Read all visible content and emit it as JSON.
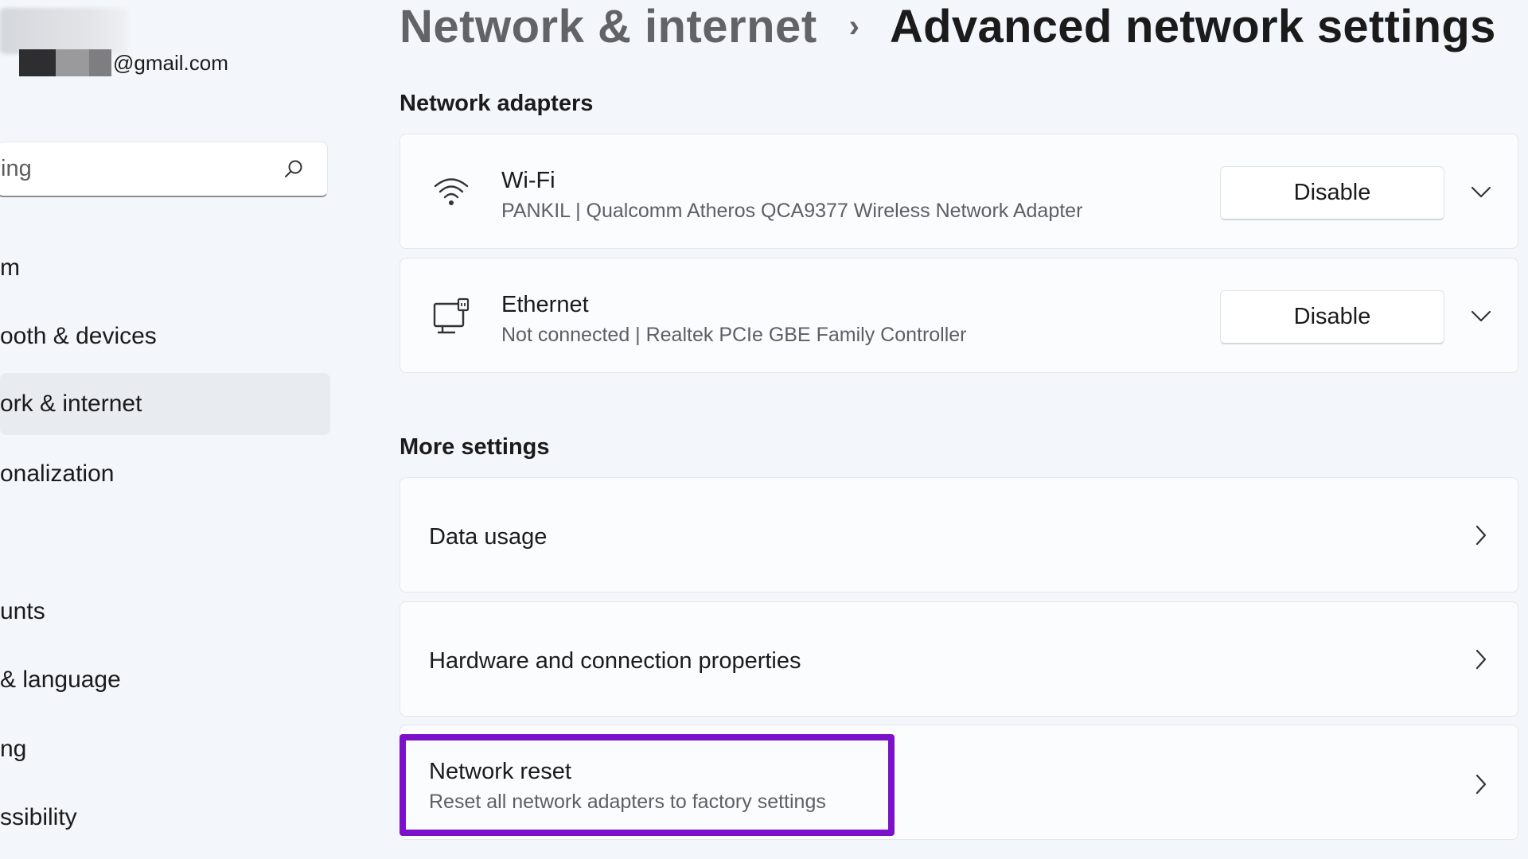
{
  "account": {
    "email_suffix": "@gmail.com"
  },
  "search": {
    "placeholder_fragment": "ing"
  },
  "sidebar": {
    "items": [
      {
        "label": "m"
      },
      {
        "label": "ooth & devices"
      },
      {
        "label": "ork & internet",
        "active": true
      },
      {
        "label": "onalization"
      },
      {
        "label": "unts"
      },
      {
        "label": " & language"
      },
      {
        "label": "ng"
      },
      {
        "label": "ssibility"
      }
    ]
  },
  "header": {
    "parent": "Network & internet",
    "separator": "›",
    "current": "Advanced network settings"
  },
  "network_adapters": {
    "title": "Network adapters",
    "adapters": [
      {
        "name": "Wi-Fi",
        "description": "PANKIL | Qualcomm Atheros QCA9377 Wireless Network Adapter",
        "button": "Disable",
        "icon": "wifi-icon"
      },
      {
        "name": "Ethernet",
        "description": "Not connected | Realtek PCIe GBE Family Controller",
        "button": "Disable",
        "icon": "ethernet-icon"
      }
    ]
  },
  "more_settings": {
    "title": "More settings",
    "items": [
      {
        "label": "Data usage"
      },
      {
        "label": "Hardware and connection properties"
      },
      {
        "label": "Network reset",
        "sublabel": "Reset all network adapters to factory settings"
      }
    ]
  },
  "colors": {
    "highlight": "#7b12c9",
    "background": "#f3f6fb",
    "card": "#fbfcfd"
  }
}
